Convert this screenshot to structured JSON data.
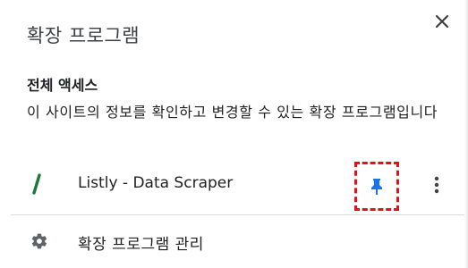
{
  "popup": {
    "title": "확장 프로그램",
    "close_icon": "close-icon"
  },
  "full_access": {
    "heading": "전체 액세스",
    "description": "이 사이트의 정보를 확인하고 변경할 수 있는 확장 프로그램입니다"
  },
  "extensions": [
    {
      "name": "Listly - Data Scraper",
      "logo_icon": "listly-logo-icon",
      "pin_icon": "pin-icon",
      "pinned": true,
      "more_icon": "more-vert-icon"
    }
  ],
  "manage": {
    "label": "확장 프로그램 관리",
    "icon": "gear-icon"
  },
  "colors": {
    "pin_blue": "#1a73e8",
    "highlight_red": "#e3101a",
    "logo_green": "#1e7a3c",
    "text": "#202124",
    "icon_gray": "#5f6368"
  }
}
